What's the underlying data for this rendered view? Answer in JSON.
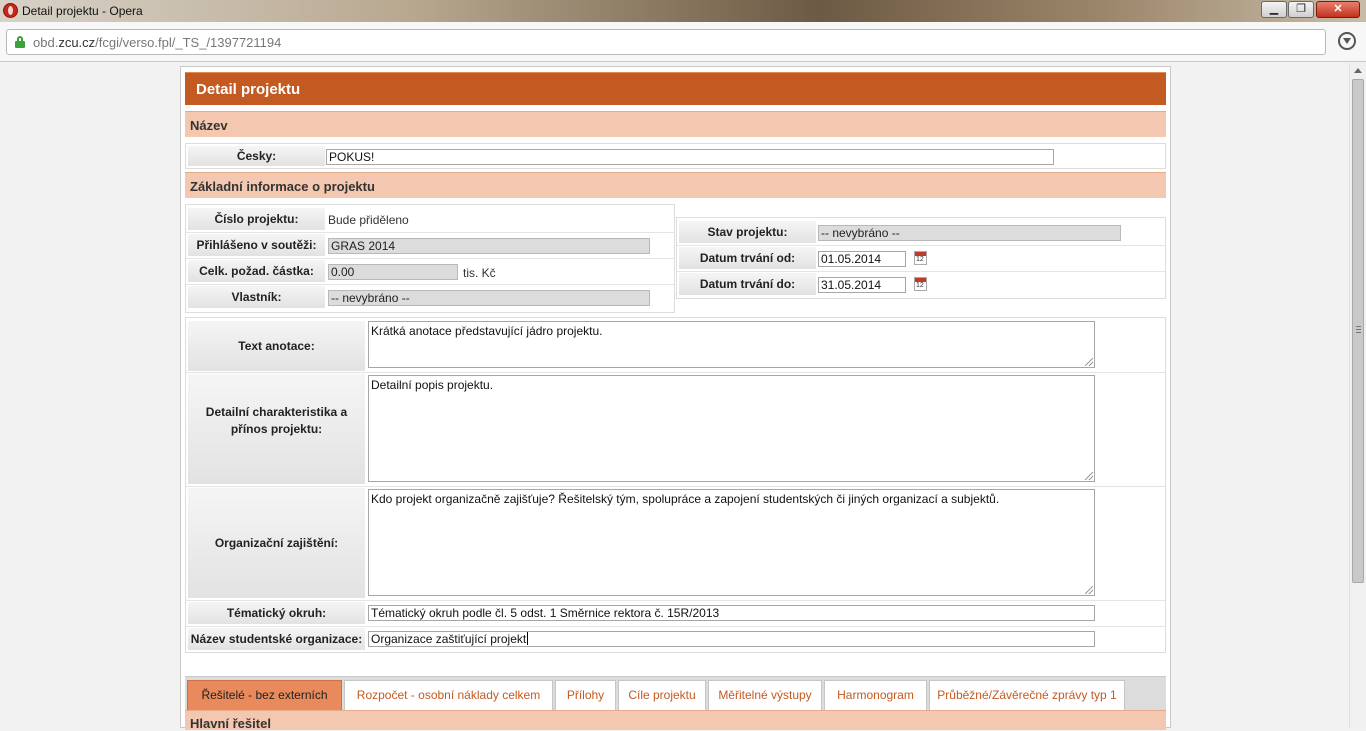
{
  "window": {
    "title": "Detail projektu - Opera"
  },
  "address_bar": {
    "url_pre": "obd.",
    "url_domain": "zcu.cz",
    "url_post": "/fcgi/verso.fpl/_TS_/1397721194"
  },
  "window_controls": {
    "minimize": "▁",
    "maximize": "❐",
    "close": "✕"
  },
  "page": {
    "title": "Detail projektu",
    "section_name": "Název",
    "name_label": "Česky:",
    "name_value": "POKUS!",
    "section_basic": "Základní informace o projektu",
    "basic": {
      "cislo_label": "Číslo projektu:",
      "cislo_value": "Bude přiděleno",
      "souteze_label": "Přihlášeno v soutěži:",
      "souteze_value": "GRAS 2014",
      "castka_label": "Celk. požad. částka:",
      "castka_value": "0.00",
      "castka_unit": "tis. Kč",
      "vlastnik_label": "Vlastník:",
      "vlastnik_value": "-- nevybráno --",
      "stav_label": "Stav projektu:",
      "stav_value": "-- nevybráno --",
      "od_label": "Datum trvání od:",
      "od_value": "01.05.2014",
      "do_label": "Datum trvání do:",
      "do_value": "31.05.2014"
    },
    "details": {
      "anotace_label": "Text anotace:",
      "anotace_value": "Krátká anotace představující jádro projektu.",
      "charakteristika_label": "Detailní charakteristika a přínos projektu:",
      "charakteristika_value": "Detailní popis projektu.",
      "zajisteni_label": "Organizační zajištění:",
      "zajisteni_value": "Kdo projekt organizačně zajišťuje? Řešitelský tým, spolupráce a zapojení studentských či jiných organizací a subjektů.",
      "okruh_label": "Tématický okruh:",
      "okruh_value": "Tématický okruh podle čl. 5 odst. 1 Směrnice rektora č. 15R/2013",
      "organizace_label": "Název studentské organizace:",
      "organizace_value": "Organizace zaštiťující projekt"
    },
    "tabs": [
      {
        "label": "Řešitelé - bez externích",
        "active": true
      },
      {
        "label": "Rozpočet - osobní náklady celkem",
        "active": false
      },
      {
        "label": "Přílohy",
        "active": false
      },
      {
        "label": "Cíle projektu",
        "active": false
      },
      {
        "label": "Měřitelné výstupy",
        "active": false
      },
      {
        "label": "Harmonogram",
        "active": false
      },
      {
        "label": "Průběžné/Závěrečné zprávy typ 1",
        "active": false
      }
    ],
    "subsection_title": "Hlavní řešitel"
  },
  "colors": {
    "header": "#c35a22",
    "section": "#f4c8b0",
    "active_tab": "#e88a5c",
    "tab_text": "#c35a22"
  }
}
